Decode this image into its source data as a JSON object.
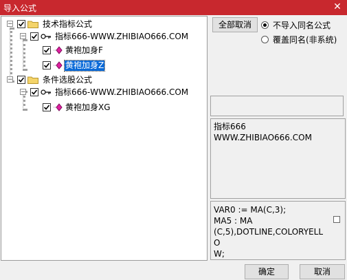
{
  "window": {
    "title": "导入公式",
    "close_glyph": "✕"
  },
  "tree": {
    "groups": [
      {
        "label": "技术指标公式",
        "item": "指标666-WWW.ZHIBIAO666.COM",
        "children": [
          {
            "label": "黄袍加身F"
          },
          {
            "label": "黄袍加身Z",
            "selected": true
          }
        ]
      },
      {
        "label": "条件选股公式",
        "item": "指标666-WWW.ZHIBIAO666.COM",
        "children": [
          {
            "label": "黄袍加身XG"
          }
        ]
      }
    ]
  },
  "options": {
    "cancel_all_label": "全部取消",
    "radio_no_import": "不导入同名公式",
    "radio_overwrite": "覆盖同名(非系统)"
  },
  "description": "指标666\nWWW.ZHIBIAO666.COM",
  "code": "VAR0 := MA(C,3);\nMA5 : MA\n(C,5),DOTLINE,COLORYELLO\nW;",
  "buttons": {
    "ok": "确定",
    "cancel": "取消"
  },
  "colors": {
    "titlebar": "#c8282e",
    "selection": "#0a6ad8"
  }
}
